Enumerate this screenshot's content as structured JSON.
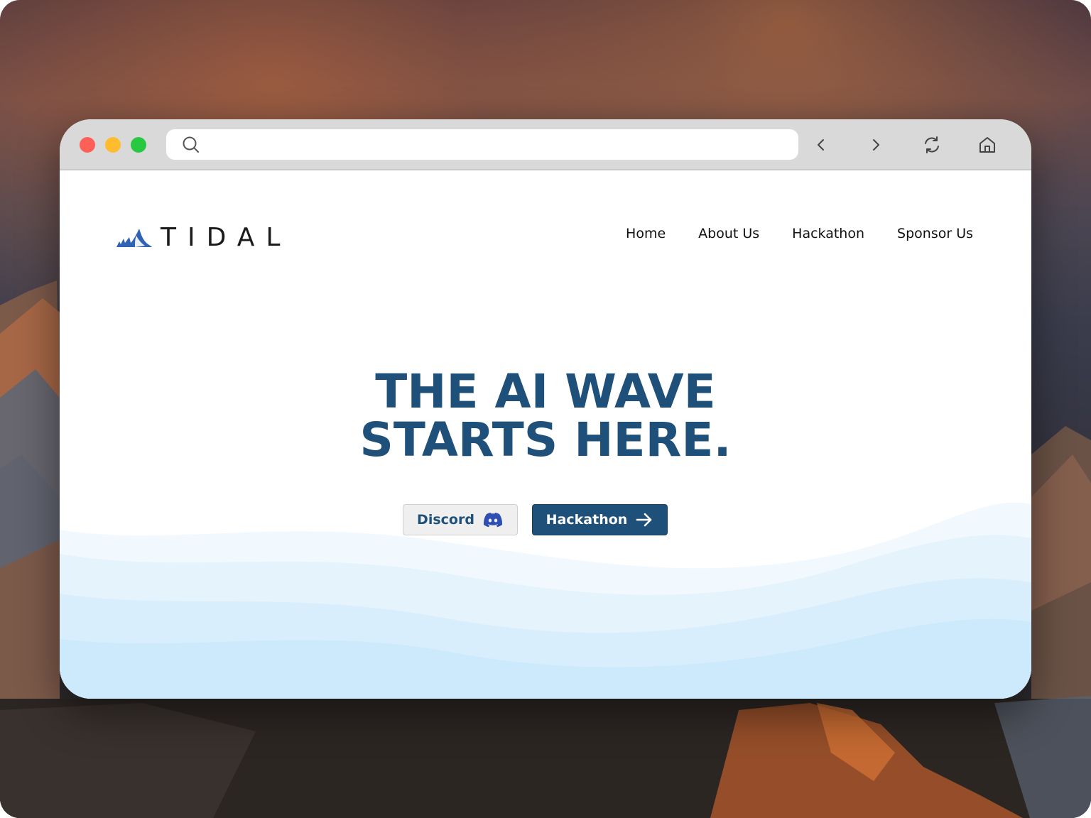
{
  "browser": {
    "url_value": "",
    "url_placeholder": "",
    "icons": [
      "search-icon",
      "chevron-left-icon",
      "chevron-right-icon",
      "refresh-icon",
      "home-icon"
    ]
  },
  "site": {
    "logo_text": "TIDAL",
    "nav": [
      {
        "label": "Home"
      },
      {
        "label": "About Us"
      },
      {
        "label": "Hackathon"
      },
      {
        "label": "Sponsor Us"
      }
    ],
    "hero": {
      "line1": "THE AI WAVE",
      "line2": "STARTS HERE."
    },
    "buttons": {
      "discord_label": "Discord",
      "hackathon_label": "Hackathon"
    }
  },
  "colors": {
    "brand_primary": "#1e5079",
    "logo_blue": "#2f62b5",
    "wave_light": "#eef7fd",
    "wave_mid": "#ddf0fc",
    "wave_deep": "#cdeafc"
  }
}
